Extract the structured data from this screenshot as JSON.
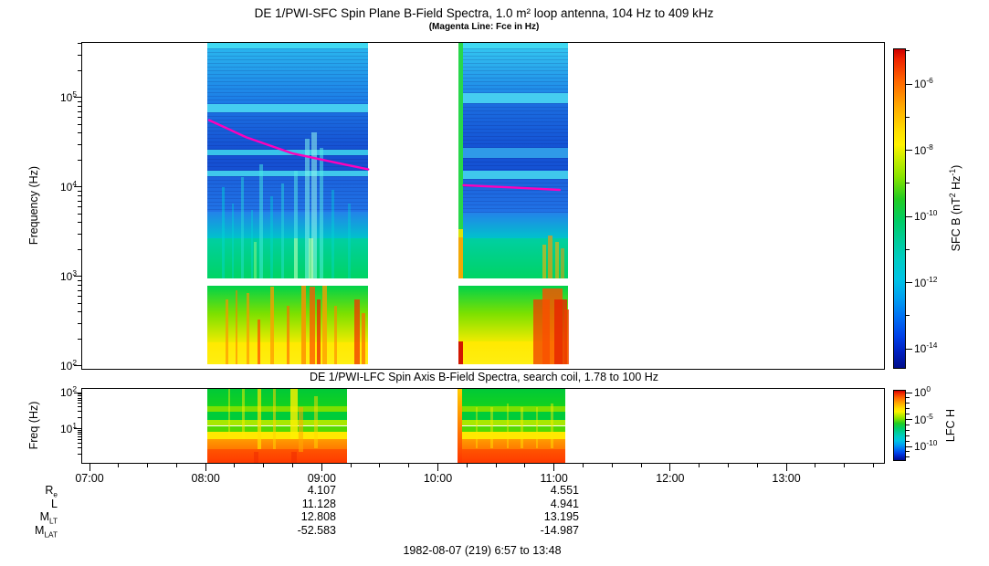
{
  "chart_data": {
    "type": "heatmap",
    "title": "DE 1/PWI-SFC  Spin Plane B-Field Spectra, 1.0 m² loop antenna, 104 Hz to 409 kHz",
    "subtitle": "(Magenta Line: Fce in Hz)",
    "magenta_color": "#ff00bb",
    "time_axis": {
      "tick_hours": [
        7,
        8,
        9,
        10,
        11,
        12,
        13
      ],
      "tick_labels": [
        "07:00",
        "08:00",
        "09:00",
        "10:00",
        "11:00",
        "12:00",
        "13:00"
      ],
      "minor_step_hours": 0.25,
      "range_text": "6:57 to 13:48"
    },
    "panels": [
      {
        "id": "sfc",
        "title": "DE 1/PWI-SFC  Spin Plane B-Field Spectra, 1.0 m² loop antenna, 104 Hz to 409 kHz",
        "ylabel": "Frequency (Hz)",
        "ytick_exponents": [
          5,
          4,
          3,
          2
        ],
        "freq_range": "104 Hz to 409 kHz",
        "colorbar": {
          "label": "SFC B (nT^2 Hz^-1)",
          "tick_labels": [
            "10^-6",
            "10^-8",
            "10^-10",
            "10^-12",
            "10^-14"
          ],
          "tick_exponents": [
            -6,
            -8,
            -10,
            -12,
            -14
          ]
        },
        "fce_line_hz": [
          [
            [
              8.03,
              56000
            ],
            [
              8.35,
              36000
            ],
            [
              8.75,
              23800
            ],
            [
              9.1,
              19000
            ],
            [
              9.4,
              15800
            ]
          ],
          [
            [
              10.22,
              10500
            ],
            [
              10.65,
              9900
            ],
            [
              11.05,
              9300
            ]
          ]
        ],
        "data_blocks": [
          {
            "t0": 8.015,
            "t1": 9.4,
            "bands": "sfc_b1",
            "streaks": [
              [
                0.1,
                3,
                0.45,
                0.734,
                "rgba(0,215,215,0.45)"
              ],
              [
                0.16,
                2,
                0.5,
                0.734,
                "rgba(0,215,215,0.40)"
              ],
              [
                0.22,
                3,
                0.42,
                0.734,
                "rgba(40,225,220,0.45)"
              ],
              [
                0.28,
                2,
                0.52,
                0.734,
                "rgba(0,215,215,0.40)"
              ],
              [
                0.335,
                4,
                0.38,
                0.734,
                "rgba(70,235,225,0.50)"
              ],
              [
                0.4,
                3,
                0.48,
                0.734,
                "rgba(0,215,215,0.40)"
              ],
              [
                0.47,
                3,
                0.44,
                0.734,
                "rgba(40,225,220,0.45)"
              ],
              [
                0.55,
                4,
                0.4,
                0.734,
                "rgba(90,240,230,0.50)"
              ],
              [
                0.62,
                5,
                0.3,
                0.734,
                "rgba(130,245,235,0.55)"
              ],
              [
                0.665,
                6,
                0.28,
                0.734,
                "rgba(150,248,238,0.55)"
              ],
              [
                0.71,
                4,
                0.33,
                0.734,
                "rgba(90,240,230,0.50)"
              ],
              [
                0.78,
                3,
                0.46,
                0.734,
                "rgba(0,215,215,0.40)"
              ],
              [
                0.88,
                3,
                0.5,
                0.734,
                "rgba(0,215,215,0.35)"
              ],
              [
                0.3,
                3,
                0.62,
                0.734,
                "rgba(170,255,130,0.45)"
              ],
              [
                0.55,
                4,
                0.61,
                0.734,
                "rgba(190,255,150,0.50)"
              ],
              [
                0.645,
                5,
                0.61,
                0.734,
                "rgba(210,255,170,0.55)"
              ],
              [
                0.12,
                3,
                0.8,
                1,
                "rgba(255,145,0,0.65)"
              ],
              [
                0.18,
                2,
                0.77,
                1,
                "rgba(255,120,0,0.55)"
              ],
              [
                0.25,
                3,
                0.78,
                1,
                "rgba(255,145,0,0.65)"
              ],
              [
                0.32,
                3,
                0.86,
                1,
                "rgba(255,70,0,0.70)"
              ],
              [
                0.4,
                4,
                0.76,
                1,
                "rgba(255,155,0,0.75)"
              ],
              [
                0.5,
                3,
                0.82,
                1,
                "rgba(255,105,0,0.65)"
              ],
              [
                0.6,
                5,
                0.757,
                1,
                "rgba(255,140,0,0.80)"
              ],
              [
                0.655,
                6,
                0.76,
                1,
                "rgba(255,85,0,0.75)"
              ],
              [
                0.69,
                4,
                0.8,
                1,
                "rgba(235,35,0,0.75)"
              ],
              [
                0.73,
                5,
                0.757,
                1,
                "rgba(255,155,0,0.75)"
              ],
              [
                0.8,
                3,
                0.82,
                1,
                "rgba(255,130,0,0.60)"
              ],
              [
                0.93,
                6,
                0.8,
                1,
                "rgba(240,55,0,0.75)"
              ],
              [
                0.97,
                4,
                0.84,
                1,
                "rgba(255,105,0,0.70)"
              ]
            ]
          },
          {
            "t0": 10.176,
            "t1": 11.12,
            "bands": "sfc_b2",
            "streaks": [
              [
                0.0,
                5,
                0,
                0.58,
                "rgba(40,215,75,1)"
              ],
              [
                0.0,
                5,
                0.58,
                0.605,
                "rgba(230,230,0,0.95)"
              ],
              [
                0.0,
                5,
                0.605,
                0.734,
                "rgba(255,165,0,0.95)"
              ],
              [
                0.02,
                5,
                0.93,
                1,
                "rgba(205,0,0,0.90)"
              ],
              [
                0.78,
                4,
                0.63,
                0.734,
                "rgba(255,175,0,0.60)"
              ],
              [
                0.84,
                5,
                0.6,
                0.734,
                "rgba(255,150,0,0.65)"
              ],
              [
                0.9,
                4,
                0.62,
                0.734,
                "rgba(255,175,0,0.60)"
              ],
              [
                0.95,
                4,
                0.64,
                0.734,
                "rgba(255,150,0,0.50)"
              ],
              [
                0.76,
                18,
                0.8,
                1,
                "rgba(240,60,0,0.75)"
              ],
              [
                0.86,
                22,
                0.765,
                1,
                "rgba(250,80,0,0.80)"
              ],
              [
                0.93,
                14,
                0.8,
                1,
                "rgba(230,35,0,0.80)"
              ],
              [
                0.985,
                5,
                0.83,
                1,
                "rgba(240,60,0,0.75)"
              ]
            ]
          }
        ]
      },
      {
        "id": "lfc",
        "title": "DE 1/PWI-LFC  Spin Axis B-Field Spectra, search coil, 1.78 to 100 Hz",
        "ylabel": "Freq (Hz)",
        "ytick_exponents": [
          2,
          1
        ],
        "freq_range": "1.78 to 100 Hz",
        "colorbar": {
          "label": "LFC H",
          "tick_labels": [
            "10^0",
            "10^-5",
            "10^-10"
          ],
          "tick_exponents": [
            0,
            -5,
            -10
          ]
        },
        "data_blocks": [
          {
            "t0": 8.015,
            "t1": 9.215,
            "bands": "lfc",
            "streaks": [
              [
                0.16,
                2,
                0.0,
                0.68,
                "rgba(255,235,0,0.45)"
              ],
              [
                0.26,
                3,
                0.0,
                0.68,
                "rgba(255,235,0,0.50)"
              ],
              [
                0.37,
                4,
                0.0,
                0.82,
                "rgba(255,225,0,0.70)"
              ],
              [
                0.48,
                3,
                0.0,
                0.82,
                "rgba(255,210,0,0.55)"
              ],
              [
                0.625,
                8,
                0.0,
                0.68,
                "rgba(255,240,0,0.80)"
              ],
              [
                0.67,
                5,
                0.25,
                0.85,
                "rgba(255,170,0,0.55)"
              ],
              [
                0.78,
                4,
                0.1,
                0.8,
                "rgba(255,215,0,0.50)"
              ],
              [
                0.35,
                5,
                0.85,
                1,
                "rgba(240,45,0,0.60)"
              ],
              [
                0.62,
                6,
                0.85,
                1,
                "rgba(240,45,0,0.60)"
              ]
            ]
          },
          {
            "t0": 10.168,
            "t1": 11.095,
            "bands": "lfc",
            "streaks": [
              [
                0.0,
                5,
                0.0,
                1,
                "#ffcc00",
                "#ff3300"
              ],
              [
                0.18,
                2,
                0.25,
                0.8,
                "rgba(255,235,0,0.40)"
              ],
              [
                0.32,
                3,
                0.25,
                0.8,
                "rgba(255,235,0,0.45)"
              ],
              [
                0.47,
                2,
                0.2,
                0.8,
                "rgba(255,235,0,0.40)"
              ],
              [
                0.6,
                3,
                0.25,
                0.8,
                "rgba(255,235,0,0.45)"
              ],
              [
                0.74,
                2,
                0.25,
                0.8,
                "rgba(255,235,0,0.40)"
              ],
              [
                0.88,
                3,
                0.2,
                0.8,
                "rgba(255,235,0,0.45)"
              ]
            ]
          }
        ]
      }
    ],
    "band_sets": {
      "sfc_b1": [
        {
          "f0": 0,
          "f1": 0.02,
          "c": "#3fd9f2"
        },
        {
          "f0": 0.02,
          "f1": 0.193,
          "c": "#29b4ee",
          "c2": "#1b7ae6",
          "stripes": true
        },
        {
          "f0": 0.193,
          "f1": 0.218,
          "c": "#45cdf0"
        },
        {
          "f0": 0.218,
          "f1": 0.334,
          "c": "#1b6ee0",
          "c2": "#1550d2",
          "stripes": true
        },
        {
          "f0": 0.334,
          "f1": 0.35,
          "c": "#38c2ea"
        },
        {
          "f0": 0.35,
          "f1": 0.399,
          "c": "#1550d2",
          "stripes": true
        },
        {
          "f0": 0.399,
          "f1": 0.416,
          "c": "#3fc8ec"
        },
        {
          "f0": 0.416,
          "f1": 0.527,
          "c": "#1b62dc",
          "c2": "#2173e6",
          "stripes": true
        },
        {
          "f0": 0.527,
          "f1": 0.609,
          "c": "#2383ea",
          "c2": "#00c2cc"
        },
        {
          "f0": 0.609,
          "f1": 0.734,
          "c": "#00cfa2",
          "c2": "#00d464"
        },
        {
          "f0": 0.734,
          "f1": 0.755,
          "c": "#ffffff"
        },
        {
          "f0": 0.755,
          "f1": 0.841,
          "c": "#00d24a",
          "c2": "#7ae000"
        },
        {
          "f0": 0.841,
          "f1": 0.932,
          "c": "#7ae000",
          "c2": "#eeeb00"
        },
        {
          "f0": 0.932,
          "f1": 1,
          "c": "#ffe900",
          "c2": "#ffee11"
        }
      ],
      "sfc_b2": [
        {
          "f0": 0,
          "f1": 0.02,
          "c": "#3fd9f2"
        },
        {
          "f0": 0.02,
          "f1": 0.16,
          "c": "#33c4f0",
          "c2": "#1e88e8",
          "stripes": true
        },
        {
          "f0": 0.16,
          "f1": 0.19,
          "c": "#45cdf0"
        },
        {
          "f0": 0.19,
          "f1": 0.33,
          "c": "#1b6ee0",
          "c2": "#1452d4",
          "stripes": true
        },
        {
          "f0": 0.33,
          "f1": 0.36,
          "c": "#2f9ae8"
        },
        {
          "f0": 0.36,
          "f1": 0.399,
          "c": "#1452d4",
          "stripes": true
        },
        {
          "f0": 0.399,
          "f1": 0.425,
          "c": "#3fc8ec"
        },
        {
          "f0": 0.425,
          "f1": 0.53,
          "c": "#1b62dc",
          "c2": "#2173e6",
          "stripes": true
        },
        {
          "f0": 0.53,
          "f1": 0.61,
          "c": "#2383ea",
          "c2": "#00c2cc"
        },
        {
          "f0": 0.61,
          "f1": 0.734,
          "c": "#00cfa2",
          "c2": "#00d464"
        },
        {
          "f0": 0.734,
          "f1": 0.755,
          "c": "#ffffff"
        },
        {
          "f0": 0.755,
          "f1": 0.84,
          "c": "#00d24a",
          "c2": "#7ae000"
        },
        {
          "f0": 0.84,
          "f1": 0.93,
          "c": "#7ae000",
          "c2": "#eeeb00"
        },
        {
          "f0": 0.93,
          "f1": 1,
          "c": "#ffe900",
          "c2": "#ffee11"
        }
      ],
      "lfc": [
        {
          "f0": 0,
          "f1": 0.24,
          "c": "#00c838",
          "c2": "#12d21e"
        },
        {
          "f0": 0.24,
          "f1": 0.31,
          "c": "#7de000"
        },
        {
          "f0": 0.31,
          "f1": 0.42,
          "c": "#00cc3a"
        },
        {
          "f0": 0.42,
          "f1": 0.5,
          "c": "#a8e800"
        },
        {
          "f0": 0.5,
          "f1": 0.58,
          "c": "#54da00"
        },
        {
          "f0": 0.58,
          "f1": 0.68,
          "c": "#ffe800"
        },
        {
          "f0": 0.68,
          "f1": 0.82,
          "c": "#ff9c00",
          "c2": "#ff7a00"
        },
        {
          "f0": 0.82,
          "f1": 1,
          "c": "#ff5500",
          "c2": "#ff3a00"
        }
      ]
    },
    "footer": {
      "row_labels": [
        "R_e",
        "L",
        "M_LT",
        "M_LAT"
      ],
      "columns": [
        {
          "under_time": "09:00",
          "values": [
            "4.107",
            "11.128",
            "12.808",
            "-52.583"
          ]
        },
        {
          "under_time": "11:00",
          "values": [
            "4.551",
            "4.941",
            "13.195",
            "-14.987"
          ]
        }
      ],
      "date_line": "1982-08-07 (219) 6:57 to 13:48"
    }
  }
}
